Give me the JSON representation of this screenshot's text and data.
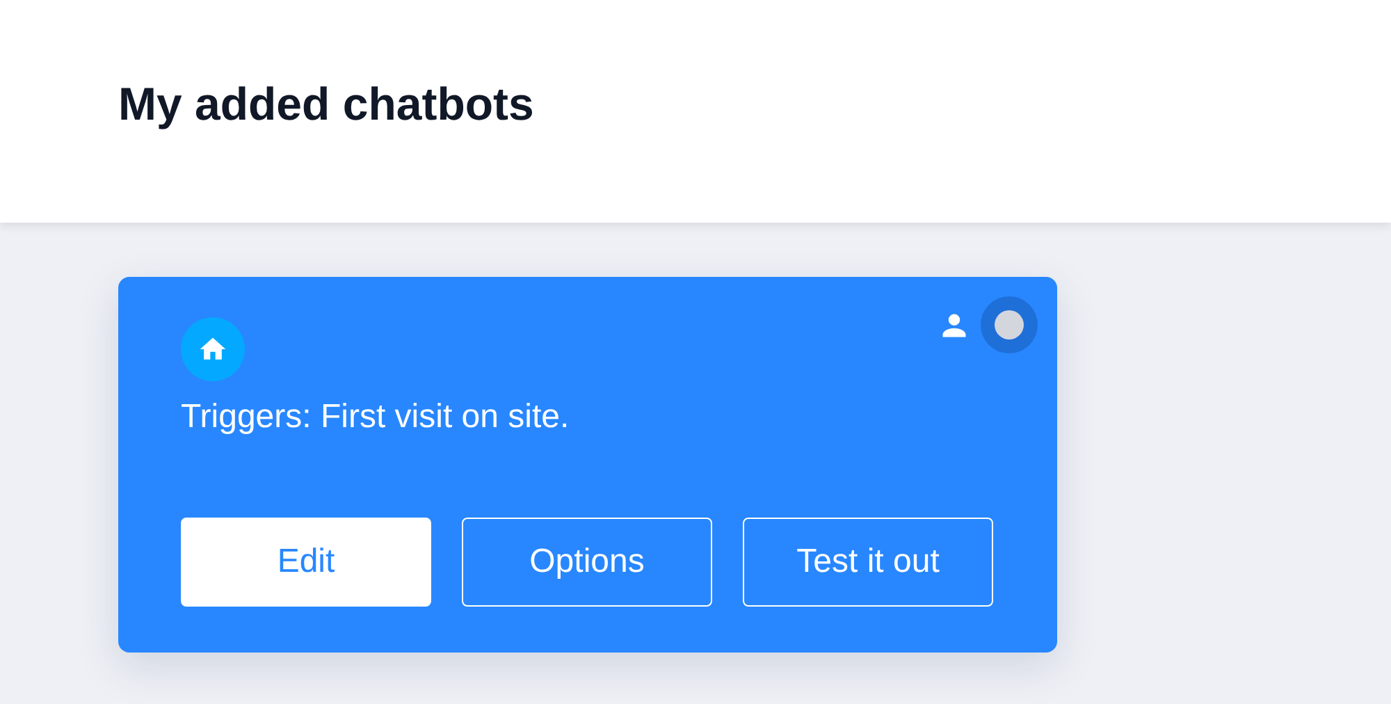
{
  "header": {
    "title": "My added chatbots"
  },
  "chatbots": [
    {
      "trigger_text": "Triggers: First visit on site.",
      "active": false,
      "buttons": [
        {
          "label": "Edit",
          "kind": "solid"
        },
        {
          "label": "Options",
          "kind": "outline"
        },
        {
          "label": "Test it out",
          "kind": "outline"
        }
      ]
    }
  ]
}
